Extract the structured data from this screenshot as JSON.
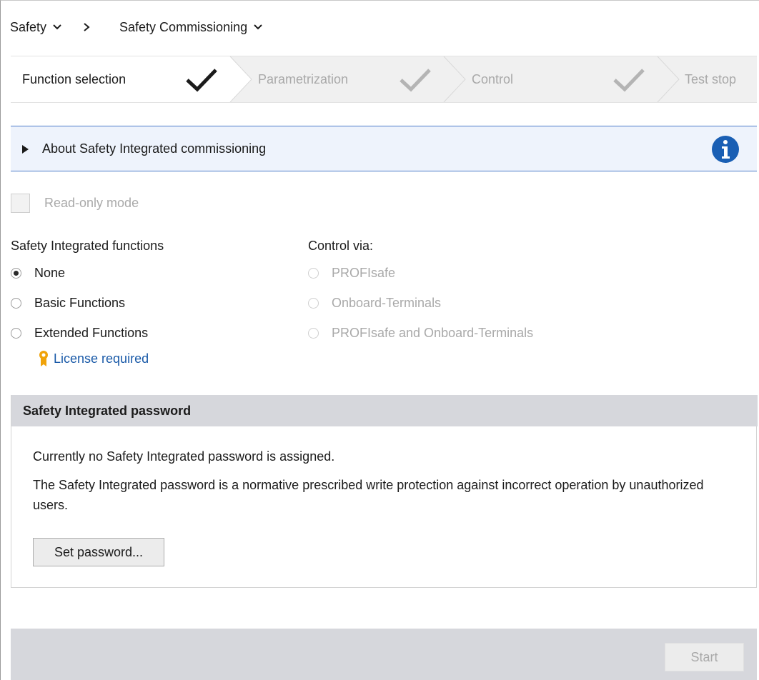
{
  "breadcrumb": {
    "item1": "Safety",
    "item2": "Safety Commissioning"
  },
  "steps": [
    {
      "label": "Function selection",
      "state": "active"
    },
    {
      "label": "Parametrization",
      "state": "inactive"
    },
    {
      "label": "Control",
      "state": "inactive"
    },
    {
      "label": "Test stop",
      "state": "inactive"
    }
  ],
  "info": {
    "label": "About Safety Integrated commissioning",
    "accent": "#1a5fb4"
  },
  "readonly": {
    "label": "Read-only mode",
    "checked": false
  },
  "functions": {
    "title": "Safety Integrated functions",
    "options": [
      {
        "label": "None",
        "selected": true
      },
      {
        "label": "Basic Functions",
        "selected": false
      },
      {
        "label": "Extended Functions",
        "selected": false
      }
    ],
    "license_link": "License required"
  },
  "control": {
    "title": "Control via:",
    "options": [
      {
        "label": "PROFIsafe",
        "enabled": false
      },
      {
        "label": "Onboard-Terminals",
        "enabled": false
      },
      {
        "label": "PROFIsafe and Onboard-Terminals",
        "enabled": false
      }
    ]
  },
  "password": {
    "title": "Safety Integrated password",
    "line1": "Currently no Safety Integrated password is assigned.",
    "line2": "The Safety Integrated password is a normative prescribed write protection against incorrect operation by unauthorized users.",
    "button": "Set password..."
  },
  "footer": {
    "start_button": "Start"
  },
  "icons": {
    "check": "check-icon",
    "info": "info-icon",
    "license": "license-icon"
  }
}
